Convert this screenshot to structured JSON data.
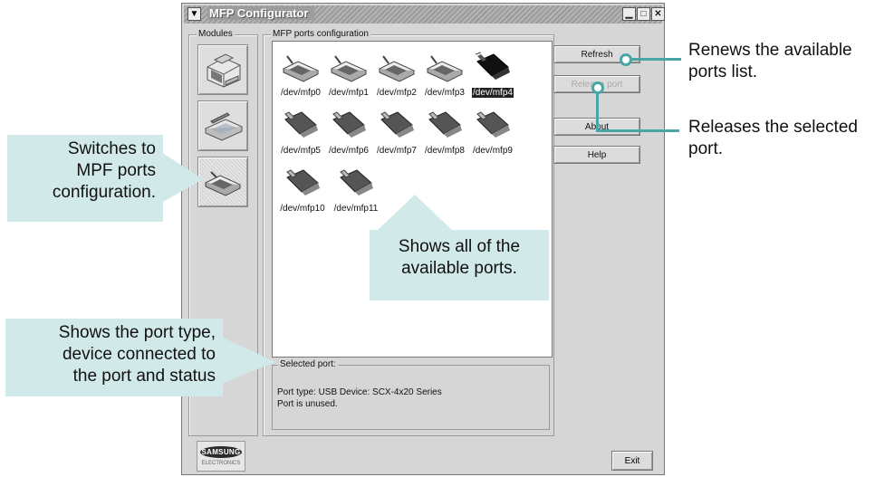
{
  "window": {
    "title": "MFP Configurator",
    "controls": {
      "minimize": "▁",
      "maximize": "□",
      "close": "✕"
    }
  },
  "modules": {
    "label": "Modules",
    "items": [
      {
        "name": "printer",
        "icon": "printer-icon"
      },
      {
        "name": "scanner",
        "icon": "scanner-icon"
      },
      {
        "name": "ports",
        "icon": "port-icon"
      }
    ]
  },
  "ports": {
    "label": "MFP ports configuration",
    "items": [
      {
        "label": "/dev/mfp0",
        "kind": "parallel",
        "selected": false
      },
      {
        "label": "/dev/mfp1",
        "kind": "parallel",
        "selected": false
      },
      {
        "label": "/dev/mfp2",
        "kind": "parallel",
        "selected": false
      },
      {
        "label": "/dev/mfp3",
        "kind": "parallel",
        "selected": false
      },
      {
        "label": "/dev/mfp4",
        "kind": "usb",
        "selected": true
      },
      {
        "label": "/dev/mfp5",
        "kind": "usb",
        "selected": false
      },
      {
        "label": "/dev/mfp6",
        "kind": "usb",
        "selected": false
      },
      {
        "label": "/dev/mfp7",
        "kind": "usb",
        "selected": false
      },
      {
        "label": "/dev/mfp8",
        "kind": "usb",
        "selected": false
      },
      {
        "label": "/dev/mfp9",
        "kind": "usb",
        "selected": false
      },
      {
        "label": "/dev/mfp10",
        "kind": "usb",
        "selected": false
      },
      {
        "label": "/dev/mfp11",
        "kind": "usb",
        "selected": false
      }
    ]
  },
  "buttons": {
    "refresh": "Refresh",
    "release_port": "Release port",
    "about": "About",
    "help": "Help",
    "exit": "Exit"
  },
  "selected_port": {
    "label": "Selected port:",
    "line1": "Port type: USB   Device: SCX-4x20 Series",
    "line2": "Port is unused."
  },
  "branding": {
    "logo": "SAMSUNG",
    "sub": "ELECTRONICS"
  },
  "annotations": {
    "switches": "Switches to\nMPF ports\nconfiguration.",
    "shows_ports": "Shows all of the\navailable ports.",
    "shows_type": "Shows the port type,\ndevice connected to\nthe port and status",
    "renews": "Renews the available\nports list.",
    "releases": "Releases the selected\nport."
  },
  "colors": {
    "callout_bg": "#d2e9e9",
    "accent": "#4aa6a6"
  }
}
